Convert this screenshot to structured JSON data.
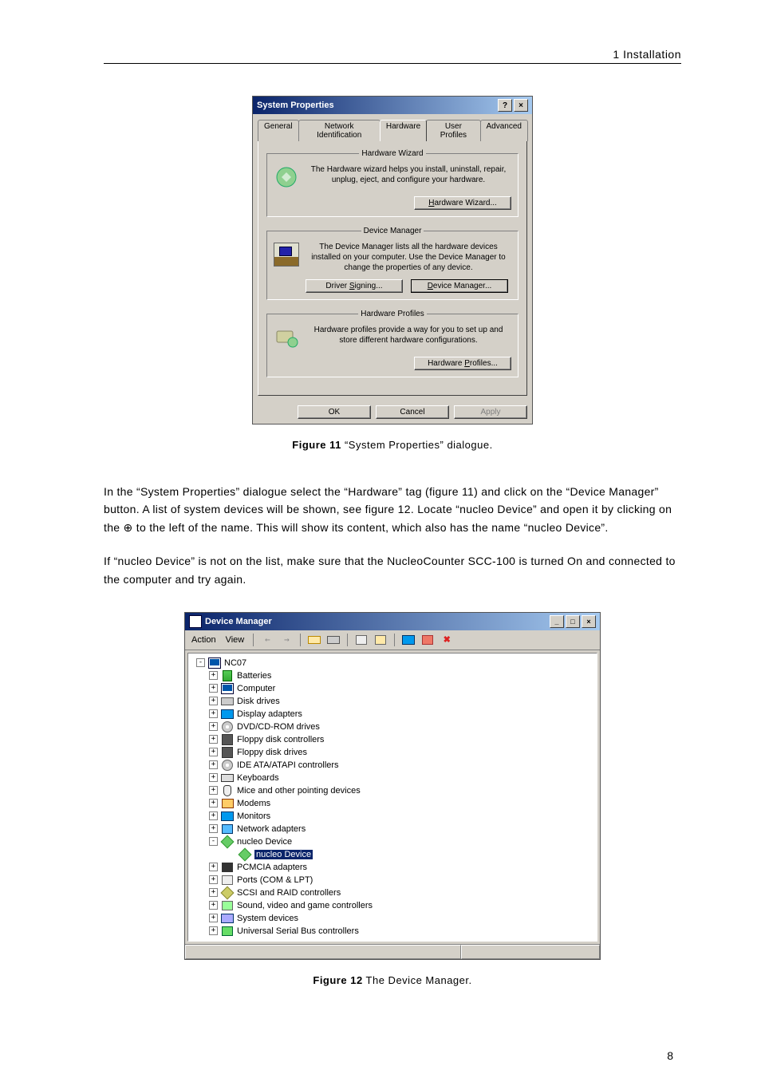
{
  "header": {
    "section": "1 Installation"
  },
  "figure11": {
    "caption_label": "Figure 11",
    "caption_text": " “System Properties” dialogue.",
    "dialog": {
      "title": "System Properties",
      "help_glyph": "?",
      "close_glyph": "×",
      "tabs": [
        "General",
        "Network Identification",
        "Hardware",
        "User Profiles",
        "Advanced"
      ],
      "active_tab_index": 2,
      "groups": {
        "hardware_wizard": {
          "legend": "Hardware Wizard",
          "desc": "The Hardware wizard helps you install, uninstall, repair, unplug, eject, and configure your hardware.",
          "button": "Hardware Wizard..."
        },
        "device_manager": {
          "legend": "Device Manager",
          "desc": "The Device Manager lists all the hardware devices installed on your computer. Use the Device Manager to change the properties of any device.",
          "button_signing": "Driver Signing...",
          "button_devmgr": "Device Manager..."
        },
        "hardware_profiles": {
          "legend": "Hardware Profiles",
          "desc": "Hardware profiles provide a way for you to set up and store different hardware configurations.",
          "button": "Hardware Profiles..."
        }
      },
      "footer": {
        "ok": "OK",
        "cancel": "Cancel",
        "apply": "Apply"
      }
    }
  },
  "body1": "In the “System Properties” dialogue select the “Hardware” tag (figure 11) and click on the “Device Manager” button. A list of system devices will be shown, see figure 12. Locate “nucleo Device” and open it by clicking on the ⊕ to the left of the name. This will show its content, which also has the name “nucleo Device”.",
  "body2": "If “nucleo Device” is not on the list, make sure that the NucleoCounter SCC-100 is turned On and connected to the computer and try again.",
  "figure12": {
    "caption_label": "Figure 12",
    "caption_text": " The Device Manager.",
    "window": {
      "title": "Device Manager",
      "min_glyph": "_",
      "max_glyph": "□",
      "close_glyph": "×",
      "menus": {
        "action": "Action",
        "view": "View"
      },
      "toolbar_icons": [
        "back",
        "forward",
        "up-folder",
        "list",
        "properties",
        "print-like",
        "monitor",
        "refresh",
        "delete"
      ],
      "root": "NC07",
      "root_expanded": true,
      "items": [
        {
          "expand": "+",
          "icon": "batt",
          "label": "Batteries"
        },
        {
          "expand": "+",
          "icon": "comp",
          "label": "Computer"
        },
        {
          "expand": "+",
          "icon": "disk",
          "label": "Disk drives"
        },
        {
          "expand": "+",
          "icon": "disp",
          "label": "Display adapters"
        },
        {
          "expand": "+",
          "icon": "cd",
          "label": "DVD/CD-ROM drives"
        },
        {
          "expand": "+",
          "icon": "floppy",
          "label": "Floppy disk controllers"
        },
        {
          "expand": "+",
          "icon": "floppy",
          "label": "Floppy disk drives"
        },
        {
          "expand": "+",
          "icon": "cd",
          "label": "IDE ATA/ATAPI controllers"
        },
        {
          "expand": "+",
          "icon": "kb",
          "label": "Keyboards"
        },
        {
          "expand": "+",
          "icon": "mouse",
          "label": "Mice and other pointing devices"
        },
        {
          "expand": "+",
          "icon": "modem",
          "label": "Modems"
        },
        {
          "expand": "+",
          "icon": "mon",
          "label": "Monitors"
        },
        {
          "expand": "+",
          "icon": "net",
          "label": "Network adapters"
        },
        {
          "expand": "-",
          "icon": "dia",
          "label": "nucleo Device",
          "children": [
            {
              "icon": "dia",
              "label": "nucleo Device",
              "selected": true
            }
          ]
        },
        {
          "expand": "+",
          "icon": "pcm",
          "label": "PCMCIA adapters"
        },
        {
          "expand": "+",
          "icon": "port",
          "label": "Ports (COM & LPT)"
        },
        {
          "expand": "+",
          "icon": "scsi",
          "label": "SCSI and RAID controllers"
        },
        {
          "expand": "+",
          "icon": "snd",
          "label": "Sound, video and game controllers"
        },
        {
          "expand": "+",
          "icon": "sys",
          "label": "System devices"
        },
        {
          "expand": "+",
          "icon": "usb",
          "label": "Universal Serial Bus controllers"
        }
      ]
    }
  },
  "page_number": "8"
}
